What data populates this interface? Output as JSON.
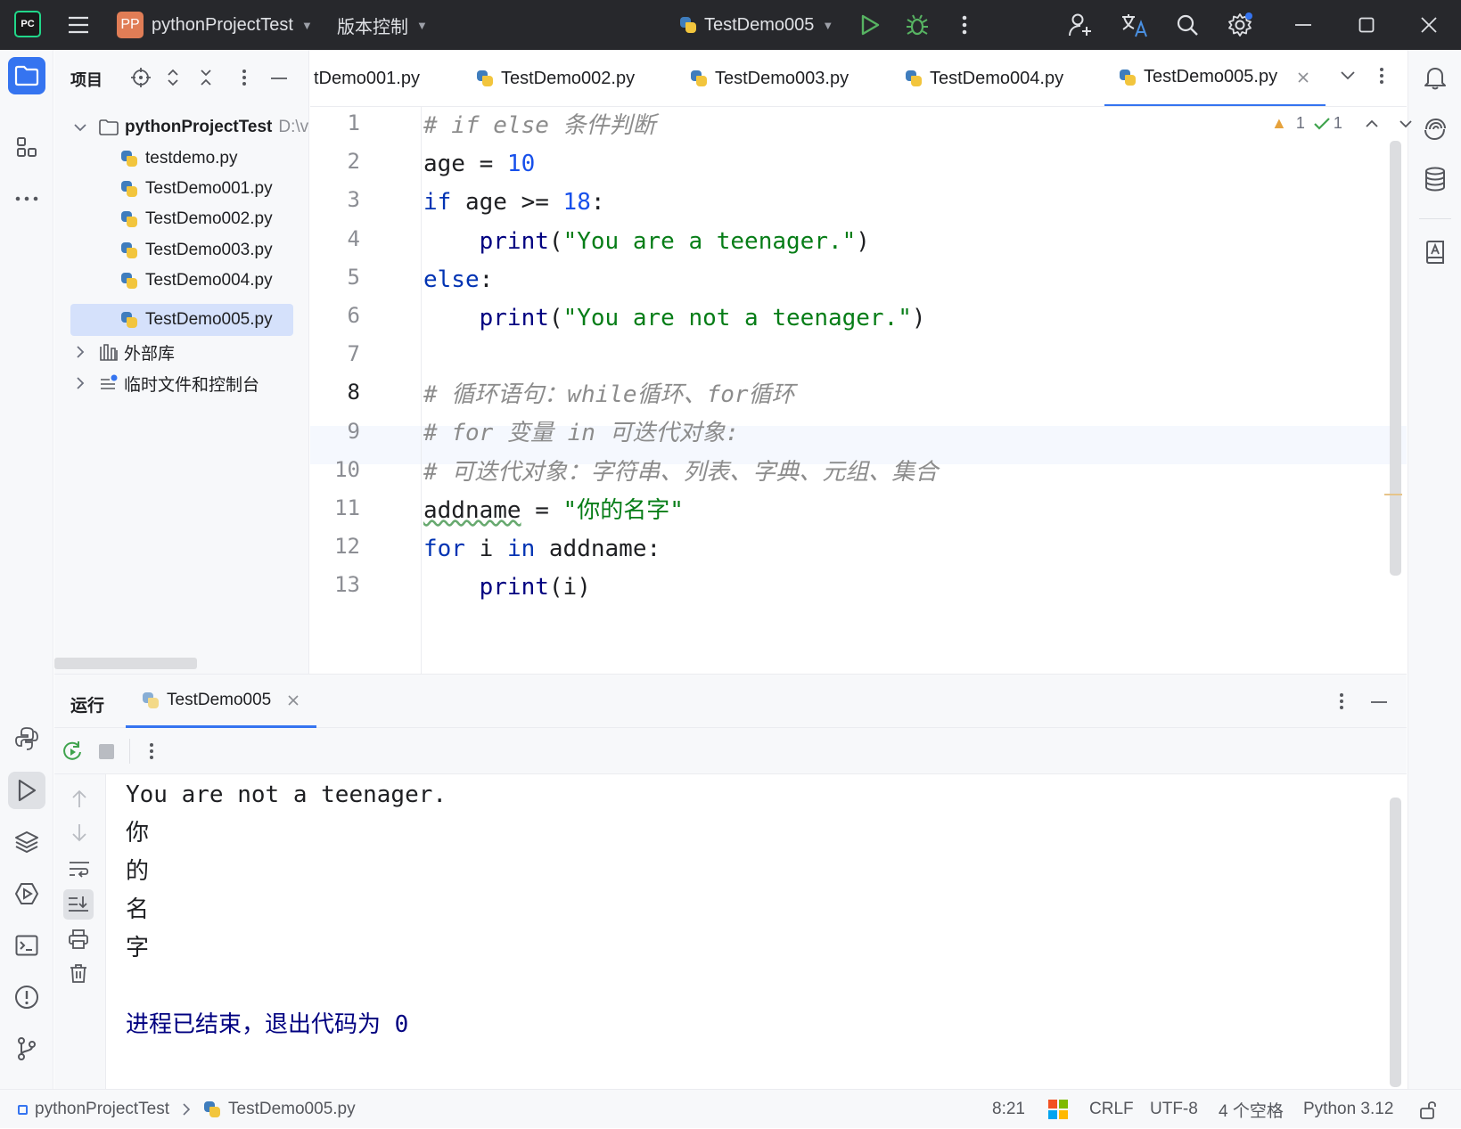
{
  "window": {
    "project_badge": "PP",
    "project_name": "pythonProjectTest",
    "vcs_label": "版本控制",
    "run_config": "TestDemo005"
  },
  "project_panel": {
    "title": "项目",
    "root_name": "pythonProjectTest",
    "root_path": "D:\\v",
    "files": [
      "testdemo.py",
      "TestDemo001.py",
      "TestDemo002.py",
      "TestDemo003.py",
      "TestDemo004.py",
      "TestDemo005.py"
    ],
    "selected_file": "TestDemo005.py",
    "nodes": [
      "外部库",
      "临时文件和控制台"
    ]
  },
  "editor": {
    "tabs": [
      "tDemo001.py",
      "TestDemo002.py",
      "TestDemo003.py",
      "TestDemo004.py",
      "TestDemo005.py"
    ],
    "active_tab": "TestDemo005.py",
    "warnings_count": "1",
    "ok_count": "1",
    "current_line": 8,
    "line_numbers": [
      "1",
      "2",
      "3",
      "4",
      "5",
      "6",
      "7",
      "8",
      "9",
      "10",
      "11",
      "12",
      "13"
    ],
    "code_lines": [
      "# if else 条件判断",
      "age = 10",
      "if age >= 18:",
      "    print(\"You are a teenager.\")",
      "else:",
      "    print(\"You are not a teenager.\")",
      "",
      "# 循环语句：while循环、for循环",
      "# for 变量 in 可迭代对象:",
      "# 可迭代对象：字符串、列表、字典、元组、集合",
      "addname = \"你的名字\"",
      "for i in addname:",
      "    print(i)"
    ]
  },
  "run_panel": {
    "title": "运行",
    "tab": "TestDemo005",
    "output": [
      "You are not a teenager.",
      "你",
      "的",
      "名",
      "字",
      "",
      "进程已结束，退出代码为 0"
    ]
  },
  "status_bar": {
    "breadcrumb_project": "pythonProjectTest",
    "breadcrumb_file": "TestDemo005.py",
    "position": "8:21",
    "line_ending": "CRLF",
    "encoding": "UTF-8",
    "indent": "4 个空格",
    "interpreter": "Python 3.12"
  },
  "colors": {
    "accent": "#3574f0",
    "keyword": "#0033b3",
    "string": "#067d17",
    "number": "#1750eb",
    "comment": "#8c8c8c",
    "run_green": "#3fa34d"
  }
}
